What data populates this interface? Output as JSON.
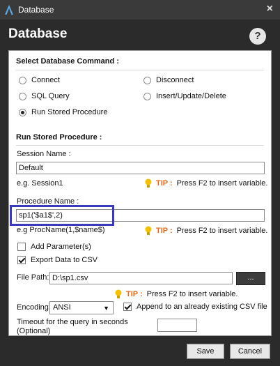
{
  "window": {
    "title": "Database",
    "close_glyph": "×",
    "logo_icon": "app-logo-icon"
  },
  "dialog": {
    "heading": "Database",
    "help_glyph": "?"
  },
  "select_command": {
    "title": "Select Database Command :",
    "options": [
      {
        "label": "Connect",
        "selected": false
      },
      {
        "label": "Disconnect",
        "selected": false
      },
      {
        "label": "SQL Query",
        "selected": false
      },
      {
        "label": "Insert/Update/Delete",
        "selected": false
      },
      {
        "label": "Run Stored Procedure",
        "selected": true
      }
    ]
  },
  "run_sp": {
    "title": "Run Stored Procedure :",
    "session": {
      "label": "Session Name :",
      "value": "Default",
      "hint": "e.g. Session1"
    },
    "procedure": {
      "label": "Procedure Name :",
      "value": "sp1('$a1$',2)",
      "hint": "e.g ProcName(1,$name$)"
    },
    "tip": {
      "tag": "TIP :",
      "text": "Press F2 to insert variable."
    },
    "add_params": {
      "label": "Add Parameter(s)",
      "checked": false
    },
    "export_csv": {
      "label": "Export Data to CSV",
      "checked": true
    },
    "file_path": {
      "label": "File Path:",
      "value": "D:\\sp1.csv",
      "browse": "..."
    },
    "encoding": {
      "label": "Encoding:",
      "value": "ANSI"
    },
    "append": {
      "label": "Append to an already existing CSV file",
      "checked": true
    },
    "timeout": {
      "label_line1": "Timeout for the query in seconds",
      "label_line2": "(Optional)",
      "value": ""
    }
  },
  "buttons": {
    "save": "Save",
    "cancel": "Cancel"
  },
  "colors": {
    "highlight": "#3b3ab8",
    "tip": "#e26a1a",
    "bulb": "#f2c200"
  }
}
